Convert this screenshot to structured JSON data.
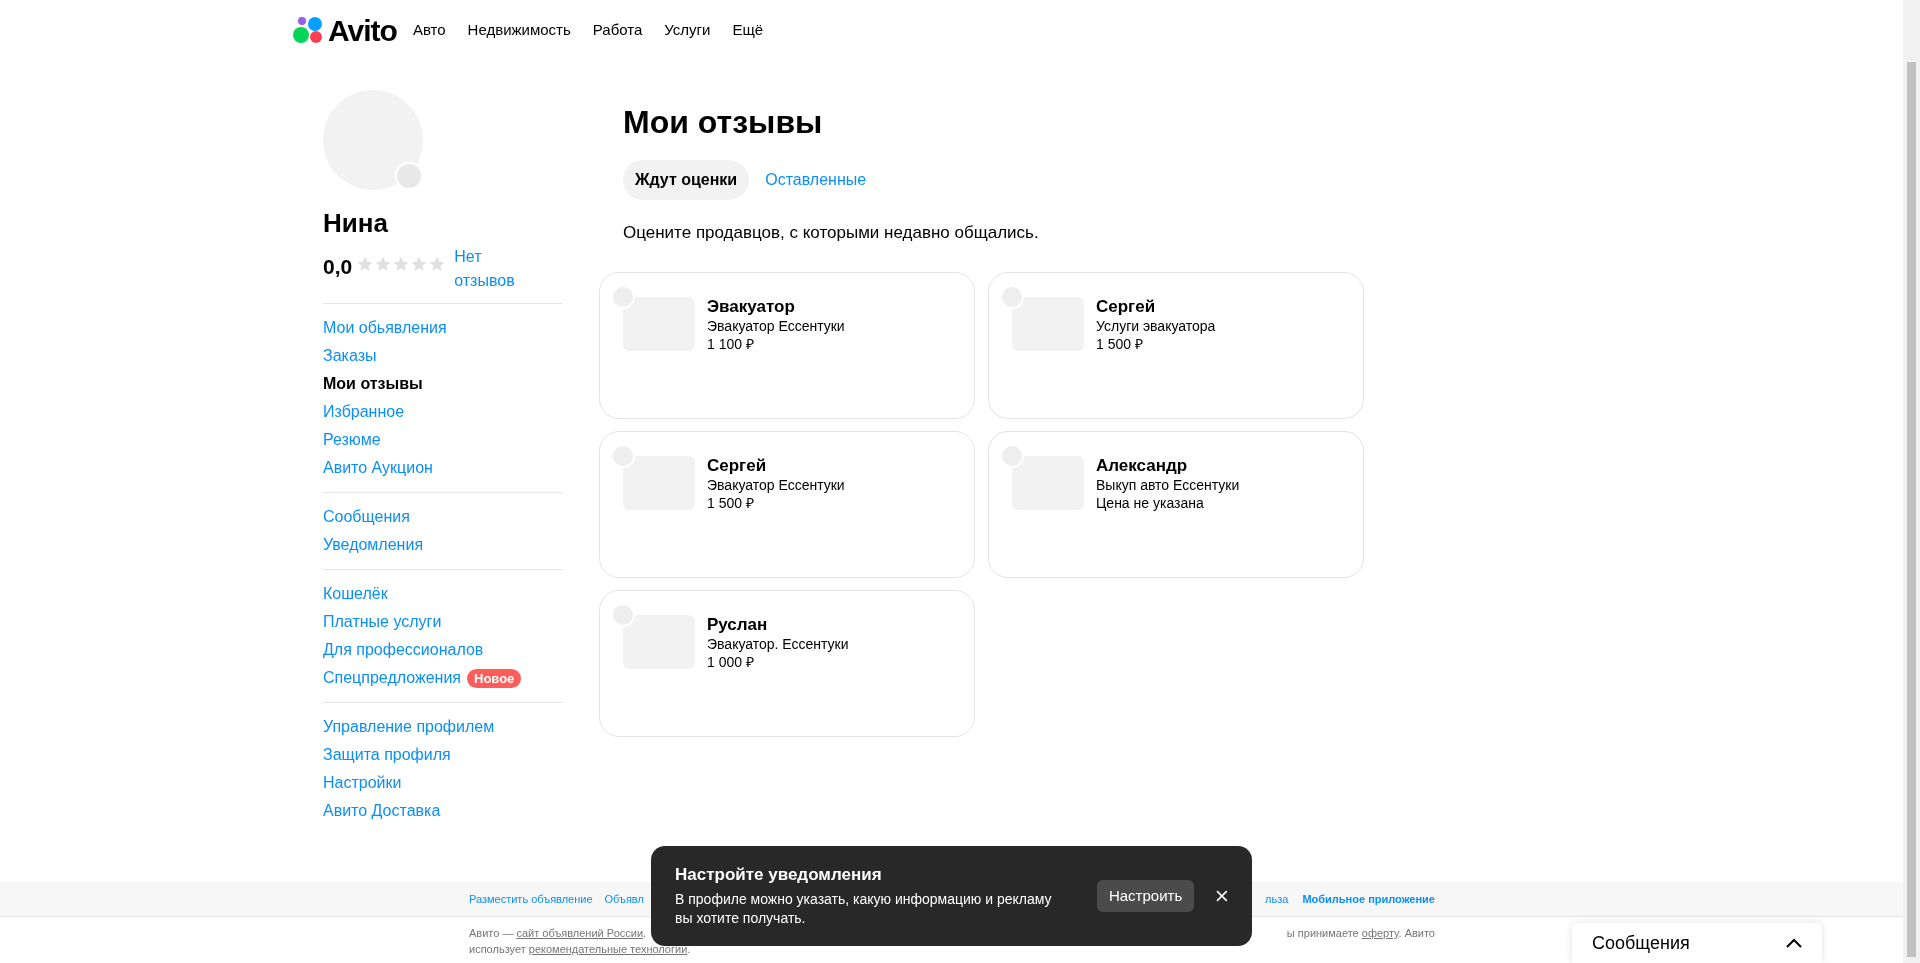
{
  "header": {
    "logo": "Avito",
    "nav": [
      "Авто",
      "Недвижимость",
      "Работа",
      "Услуги",
      "Ещё"
    ]
  },
  "profile": {
    "name": "Нина",
    "rating": "0,0",
    "stars": 0,
    "reviews_link": "Нет отзывов"
  },
  "sidebar": {
    "groups": [
      [
        {
          "label": "Мои обьявления",
          "selected": false
        },
        {
          "label": "Заказы",
          "selected": false
        },
        {
          "label": "Мои отзывы",
          "selected": true
        },
        {
          "label": "Избранное",
          "selected": false
        },
        {
          "label": "Резюме",
          "selected": false
        },
        {
          "label": "Авито Аукцион",
          "selected": false
        }
      ],
      [
        {
          "label": "Сообщения",
          "selected": false
        },
        {
          "label": "Уведомления",
          "selected": false
        }
      ],
      [
        {
          "label": "Кошелёк",
          "selected": false
        },
        {
          "label": "Платные услуги",
          "selected": false
        },
        {
          "label": "Для профессионалов",
          "selected": false
        },
        {
          "label": "Спецпредложения",
          "selected": false,
          "badge": "Новое"
        }
      ],
      [
        {
          "label": "Управление профилем",
          "selected": false
        },
        {
          "label": "Защита профиля",
          "selected": false
        },
        {
          "label": "Настройки",
          "selected": false
        },
        {
          "label": "Авито Доставка",
          "selected": false
        }
      ]
    ]
  },
  "page": {
    "title": "Мои отзывы",
    "tabs": [
      {
        "label": "Ждут оценки",
        "selected": true
      },
      {
        "label": "Оставленные",
        "selected": false
      }
    ],
    "subtitle": "Оцените продавцов, с которыми недавно общались."
  },
  "cards": [
    {
      "name": "Эвакуатор",
      "listing": "Эвакуатор Ессентуки",
      "price": "1 100 ₽"
    },
    {
      "name": "Сергей",
      "listing": "Услуги эвакуатора",
      "price": "1 500 ₽"
    },
    {
      "name": "Сергей",
      "listing": "Эвакуатор Ессентуки",
      "price": "1 500 ₽"
    },
    {
      "name": "Александр",
      "listing": "Выкуп авто Ессентуки",
      "price": "Цена не указана"
    },
    {
      "name": "Руслан",
      "listing": "Эвакуатор. Ессентуки",
      "price": "1 000 ₽"
    }
  ],
  "footer": {
    "links_left": [
      "Разместить объявление",
      "Объявл"
    ],
    "links_right": [
      {
        "label": "льза",
        "bold": false
      },
      {
        "label": "Мобильное приложение",
        "bold": true
      }
    ],
    "note_left": [
      {
        "text": "Авито — ",
        "link": false
      },
      {
        "text": "сайт объявлений России",
        "link": true
      },
      {
        "text": ".",
        "link": false
      }
    ],
    "note_right": [
      {
        "text": "ы принимаете ",
        "link": false
      },
      {
        "text": "оферту",
        "link": true
      },
      {
        "text": ". Авито",
        "link": false
      }
    ],
    "note_line2": [
      {
        "text": "использует ",
        "link": false
      },
      {
        "text": "рекомендательные технологии",
        "link": true
      },
      {
        "text": ".",
        "link": false
      }
    ]
  },
  "toast": {
    "title": "Настройте уведомления",
    "text": "В профиле можно указать, какую информацию и рекламу вы хотите получать.",
    "button": "Настроить"
  },
  "messages_widget": {
    "label": "Сообщения",
    "expanded": false
  }
}
